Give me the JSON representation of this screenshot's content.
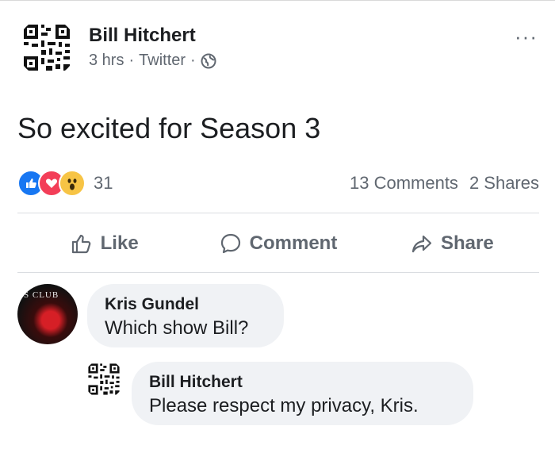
{
  "post": {
    "author": "Bill Hitchert",
    "time": "3 hrs",
    "source": "Twitter",
    "separator": "·",
    "more_label": "···",
    "text": "So excited for Season 3",
    "reaction_count": "31",
    "comments_count": "13 Comments",
    "shares_count": "2 Shares"
  },
  "actions": {
    "like": "Like",
    "comment": "Comment",
    "share": "Share"
  },
  "comments": [
    {
      "author": "Kris Gundel",
      "text": "Which show Bill?",
      "avatar_text": "S CLUB"
    },
    {
      "author": "Bill Hitchert",
      "text": "Please respect my privacy, Kris."
    }
  ],
  "colors": {
    "like_blue": "#1877f2",
    "love_red": "#f33e58",
    "wow_yellow": "#f7c445",
    "muted_text": "#606770",
    "bubble_bg": "#f0f2f5"
  },
  "icons": [
    "qr-code-avatar-icon",
    "globe-icon",
    "like-reaction-icon",
    "love-reaction-icon",
    "wow-reaction-icon",
    "thumbs-up-icon",
    "comment-icon",
    "share-arrow-icon"
  ]
}
